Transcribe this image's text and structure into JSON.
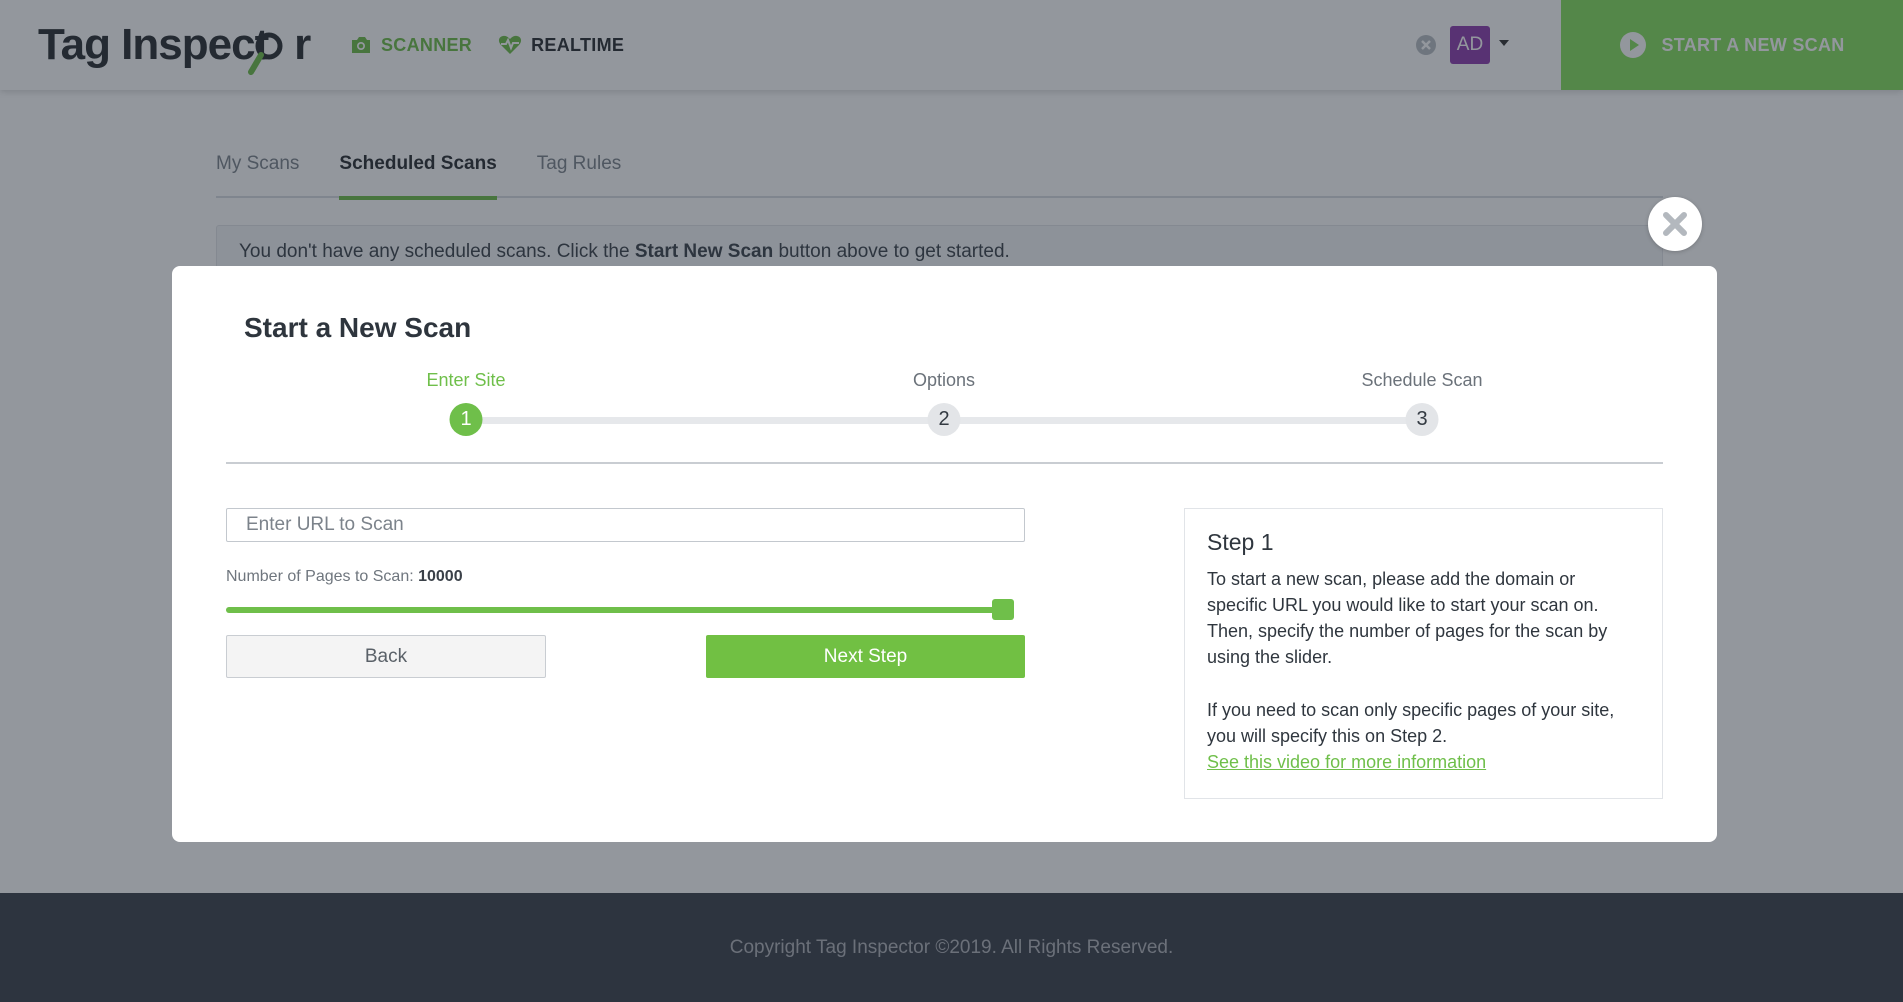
{
  "header": {
    "logo_text": "Tag Inspect",
    "logo_tail": "r",
    "nav": [
      {
        "label": "SCANNER",
        "icon": "camera-icon",
        "active": true
      },
      {
        "label": "REALTIME",
        "icon": "heartbeat-icon",
        "active": false
      }
    ],
    "avatar_initials": "AD",
    "new_scan_label": "START A NEW SCAN",
    "accent_color": "#86e05e"
  },
  "tabs": [
    {
      "label": "My Scans",
      "active": false
    },
    {
      "label": "Scheduled Scans",
      "active": true
    },
    {
      "label": "Tag Rules",
      "active": false
    }
  ],
  "alert": {
    "prefix": "You don't have any scheduled scans. Click the ",
    "bold": "Start New Scan",
    "suffix": " button above to get started."
  },
  "modal": {
    "title": "Start a New Scan",
    "steps": [
      {
        "label": "Enter Site",
        "number": "1",
        "active": true
      },
      {
        "label": "Options",
        "number": "2",
        "active": false
      },
      {
        "label": "Schedule Scan",
        "number": "3",
        "active": false
      }
    ],
    "url_placeholder": "Enter URL to Scan",
    "pages_label": "Number of Pages to Scan: ",
    "pages_value": "10000",
    "slider_fraction": 1.0,
    "back_label": "Back",
    "next_label": "Next Step",
    "help": {
      "title": "Step 1",
      "para1": "To start a new scan, please add the domain or specific URL you would like to start your scan on. Then, specify the number of pages for the scan by using the slider.",
      "para2": "If you need to scan only specific pages of your site, you will specify this on Step 2.",
      "link": "See this video for more information"
    }
  },
  "footer": {
    "copyright": "Copyright Tag Inspector ©2019. All Rights Reserved."
  }
}
